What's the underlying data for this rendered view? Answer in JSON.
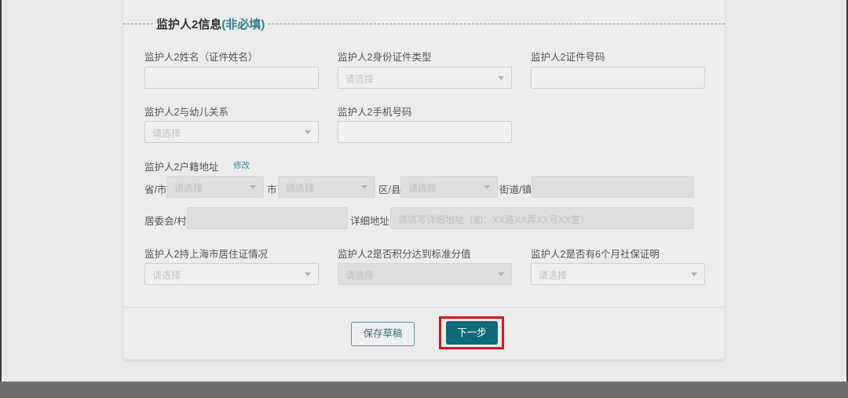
{
  "section": {
    "title": "监护人2信息",
    "optional_tag": "(非必填)"
  },
  "fields": {
    "name": {
      "label": "监护人2姓名（证件姓名）",
      "value": ""
    },
    "id_type": {
      "label": "监护人2身份证件类型",
      "placeholder": "请选择"
    },
    "id_number": {
      "label": "监护人2证件号码",
      "value": ""
    },
    "relation": {
      "label": "监护人2与幼儿关系",
      "placeholder": "请选择"
    },
    "phone": {
      "label": "监护人2手机号码",
      "value": ""
    },
    "household": {
      "label": "监护人2户籍地址",
      "edit_link": "修改",
      "province_label": "省/市",
      "province_placeholder": "请选择",
      "city_label": "市",
      "city_placeholder": "请选择",
      "district_label": "区/县",
      "district_placeholder": "请选择",
      "street_label": "街道/镇",
      "committee_label": "居委会/村",
      "detail_label": "详细地址",
      "detail_placeholder": "请填写详细地址（如：XX路XX弄XX号XX室）"
    },
    "residence_permit": {
      "label": "监护人2持上海市居住证情况",
      "placeholder": "请选择"
    },
    "score_standard": {
      "label": "监护人2是否积分达到标准分值",
      "placeholder": "请选择"
    },
    "social_security": {
      "label": "监护人2是否有6个月社保证明",
      "placeholder": "请选择"
    }
  },
  "actions": {
    "save_draft": "保存草稿",
    "next_step": "下一步"
  },
  "colors": {
    "accent": "#0f6b79",
    "highlight": "#e0141e",
    "optional_tag": "#2f7f8a"
  }
}
